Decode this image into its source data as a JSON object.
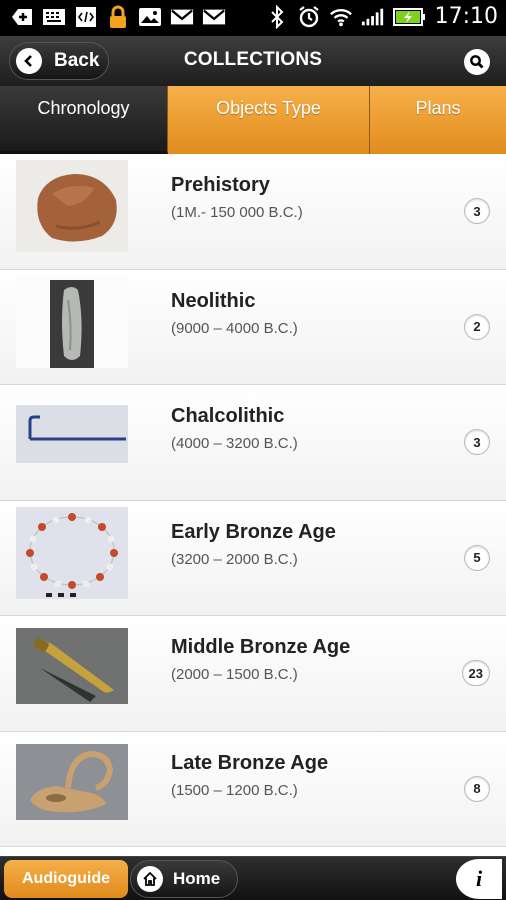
{
  "status_bar": {
    "time": "17:10",
    "icons": [
      "add-icon",
      "keyboard-icon",
      "code-icon",
      "lock-icon",
      "image-icon",
      "gmail-icon",
      "gmail-icon",
      "bluetooth-icon",
      "alarm-icon",
      "wifi-icon",
      "signal-icon",
      "battery-charging-icon"
    ]
  },
  "header": {
    "back_label": "Back",
    "title": "COLLECTIONS",
    "search_icon": "search-icon"
  },
  "tabs": [
    {
      "label": "Chronology",
      "active": true
    },
    {
      "label": "Objects Type",
      "active": false
    },
    {
      "label": "Plans",
      "active": false
    }
  ],
  "items": [
    {
      "title": "Prehistory",
      "period": "(1M.- 150 000 B.C.)",
      "count": "3",
      "thumb": "flint-stone"
    },
    {
      "title": "Neolithic",
      "period": "(9000 – 4000 B.C.)",
      "count": "2",
      "thumb": "stone-axe"
    },
    {
      "title": "Chalcolithic",
      "period": "(4000 – 3200 B.C.)",
      "count": "3",
      "thumb": "copper-pin"
    },
    {
      "title": "Early Bronze Age",
      "period": "(3200 – 2000 B.C.)",
      "count": "5",
      "thumb": "bead-necklace"
    },
    {
      "title": "Middle Bronze Age",
      "period": "(2000 – 1500 B.C.)",
      "count": "23",
      "thumb": "bronze-dagger"
    },
    {
      "title": "Late Bronze Age",
      "period": "(1500 – 1200 B.C.)",
      "count": "8",
      "thumb": "clay-oil-lamp"
    }
  ],
  "bottom_bar": {
    "audioguide_label": "Audioguide",
    "home_label": "Home",
    "info_label": "i"
  },
  "colors": {
    "accent_orange": "#e8952a",
    "header_dark": "#2a2a2a"
  }
}
